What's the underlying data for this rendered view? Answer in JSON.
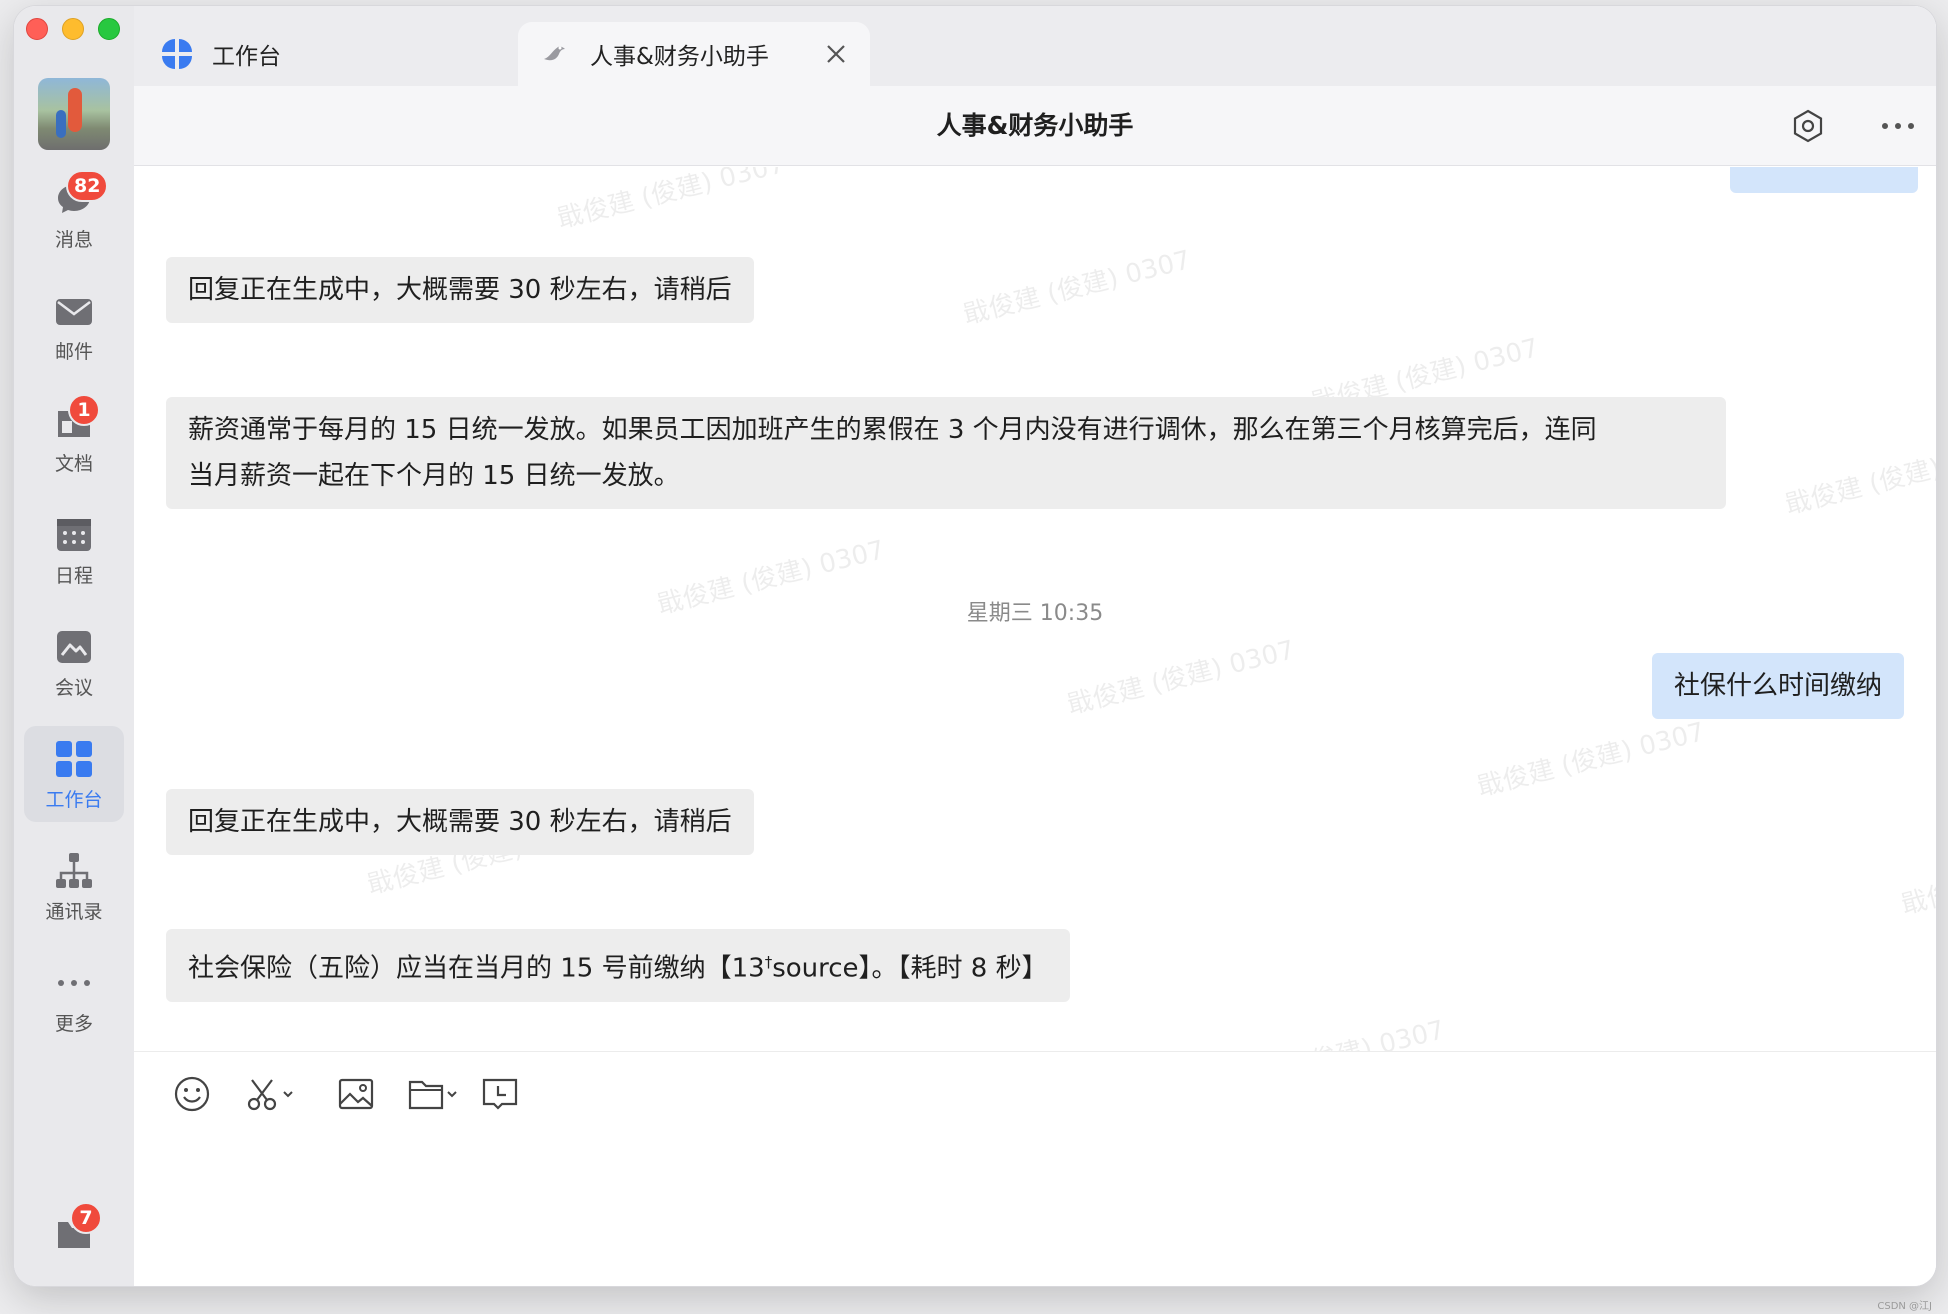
{
  "window": {
    "traffic_lights": [
      "close",
      "minimize",
      "zoom"
    ]
  },
  "sidebar": {
    "items": [
      {
        "label": "消息",
        "icon": "chat-bubble-icon",
        "badge": "82"
      },
      {
        "label": "邮件",
        "icon": "mail-icon"
      },
      {
        "label": "文档",
        "icon": "doc-icon",
        "badge": "1"
      },
      {
        "label": "日程",
        "icon": "calendar-icon"
      },
      {
        "label": "会议",
        "icon": "meeting-icon"
      },
      {
        "label": "工作台",
        "icon": "workspace-grid-icon",
        "active": true
      },
      {
        "label": "通讯录",
        "icon": "org-chart-icon"
      },
      {
        "label": "更多",
        "icon": "more-dots-icon"
      }
    ],
    "bottom_badge": "7"
  },
  "tabs": [
    {
      "label": "工作台",
      "icon": "workspace-logo-icon"
    },
    {
      "label": "人事&财务小助手",
      "icon": "assistant-bird-icon",
      "active": true
    }
  ],
  "header": {
    "title": "人事&财务小助手"
  },
  "watermark": {
    "text": "戢俊建 (俊建) 0307"
  },
  "messages": [
    {
      "from": "bot",
      "text": "回复正在生成中，大概需要 30 秒左右，请稍后"
    },
    {
      "from": "bot",
      "lines": [
        "薪资通常于每月的 15 日统一发放。如果员工因加班产生的累假在 3 个月内没有进行调休，那么在第三个月核算完后，连同",
        "当月薪资一起在下个月的 15 日统一发放。"
      ]
    },
    {
      "timestamp": "星期三 10:35"
    },
    {
      "from": "me",
      "text": "社保什么时间缴纳"
    },
    {
      "from": "bot",
      "text": "回复正在生成中，大概需要 30 秒左右，请稍后"
    },
    {
      "from": "bot",
      "text_pre": "社会保险（五险）应当在当月的 15 号前缴纳【13",
      "sup": "†",
      "text_post": "source】。【耗时 8 秒】"
    }
  ],
  "composer": {
    "tools": [
      "emoji-icon",
      "screenshot-scissors-icon",
      "image-icon",
      "folder-icon",
      "schedule-message-icon"
    ]
  },
  "colors": {
    "accent": "#3a7bf0",
    "badge": "#f04a3c",
    "bot_bubble": "#ededed",
    "me_bubble": "#d3e5fb"
  },
  "credit": "CSDN @江J"
}
